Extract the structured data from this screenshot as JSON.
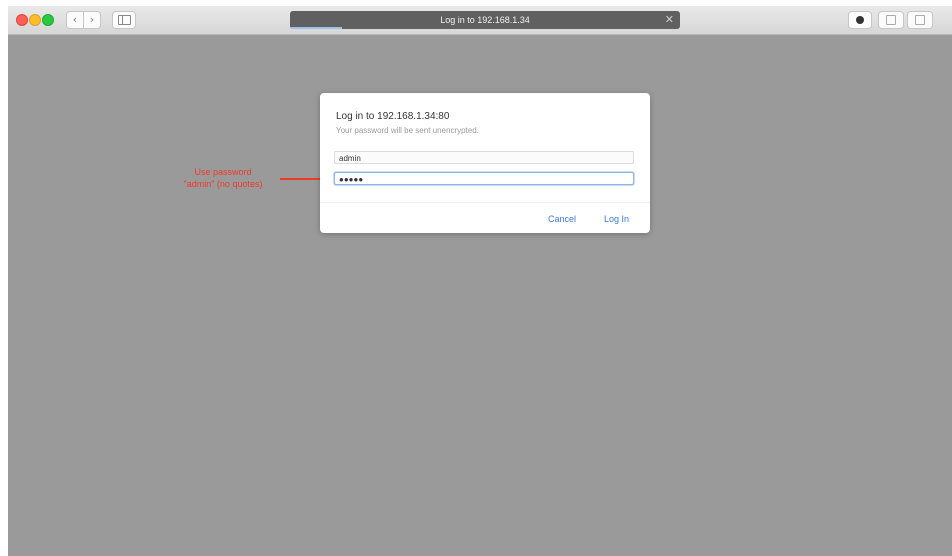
{
  "browser": {
    "address_title": "Log in to 192.168.1.34",
    "back_icon": "chevron-left-icon",
    "forward_icon": "chevron-right-icon",
    "back_glyph": "‹",
    "forward_glyph": "›",
    "close_glyph": "✕",
    "sidebar_icon": "sidebar-icon",
    "extension_icon": "extension-dot-icon",
    "share_icon": "share-icon",
    "tabs_icon": "tabs-icon"
  },
  "dialog": {
    "title": "Log in to 192.168.1.34:80",
    "subtitle": "Your password will be sent unencrypted.",
    "username_value": "admin",
    "password_value": "●●●●●",
    "cancel_label": "Cancel",
    "login_label": "Log In"
  },
  "annotation": {
    "line1": "Use password",
    "line2": "\"admin\" (no quotes)"
  },
  "colors": {
    "background": "#9a9a9a",
    "link_blue": "#3a7bd5",
    "annotation_red": "#ee3b2a"
  }
}
